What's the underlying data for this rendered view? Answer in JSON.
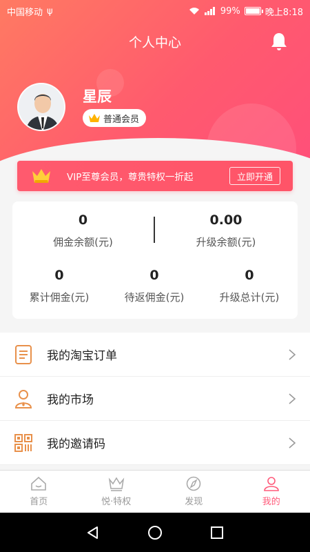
{
  "status_bar": {
    "carrier": "中国移动",
    "signal_extra": "ψ",
    "battery": "99%",
    "battery_level": 0.99,
    "time": "晚上8:18"
  },
  "header": {
    "title": "个人中心",
    "bell_icon": "bell-icon"
  },
  "profile": {
    "username": "星辰",
    "member_level": "普通会员",
    "badge_icon": "crown-icon"
  },
  "vip_banner": {
    "text": "VIP至尊会员，尊贵特权一折起",
    "button": "立即开通",
    "icon": "crown-icon"
  },
  "stats": {
    "commission_balance": {
      "value": "0",
      "label": "佣金余额(元)"
    },
    "upgrade_balance": {
      "value": "0.00",
      "label": "升级余额(元)"
    },
    "total_commission": {
      "value": "0",
      "label": "累计佣金(元)"
    },
    "pending_commission": {
      "value": "0",
      "label": "待返佣金(元)"
    },
    "upgrade_total": {
      "value": "0",
      "label": "升级总计(元)"
    }
  },
  "menu": [
    {
      "label": "我的淘宝订单",
      "icon": "order-document-icon"
    },
    {
      "label": "我的市场",
      "icon": "user-market-icon"
    },
    {
      "label": "我的邀请码",
      "icon": "qr-code-icon"
    }
  ],
  "tabs": [
    {
      "label": "首页",
      "icon": "home-icon"
    },
    {
      "label": "悦·特权",
      "icon": "crown-icon"
    },
    {
      "label": "发现",
      "icon": "compass-icon"
    },
    {
      "label": "我的",
      "icon": "user-icon"
    }
  ],
  "colors": {
    "accent": "#ff5a7a",
    "header_start": "#ff7a62",
    "header_end": "#ff4f7a",
    "icon_orange": "#e8904a"
  }
}
